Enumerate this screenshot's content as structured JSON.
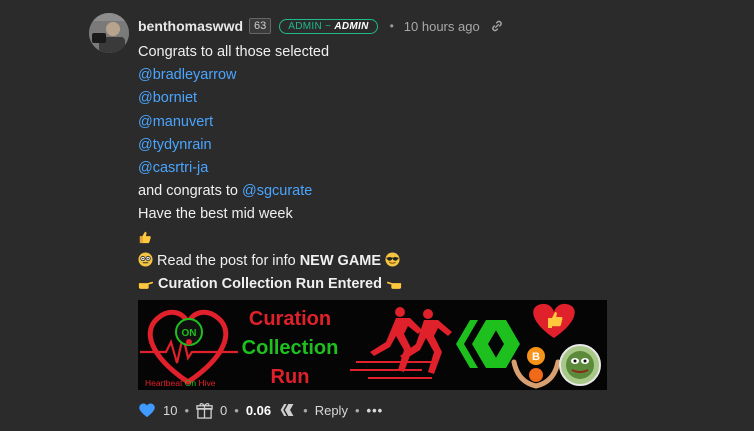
{
  "comment": {
    "author": "benthomaswwd",
    "reputation": "63",
    "role_prefix": "ADMIN ~",
    "role_title": "ADMIN",
    "time_ago": "10 hours ago",
    "lines": {
      "congrats": "Congrats to all those selected",
      "mentions": [
        "@bradleyarrow",
        "@borniet",
        "@manuvert",
        "@tydynrain",
        "@casrtri-ja"
      ],
      "and_congrats": "and congrats to ",
      "and_mention": "@sgcurate",
      "midweek": "Have the best mid week",
      "read_post": "Read the post for info ",
      "new_game": "NEW GAME",
      "curation_entered": "Curation Collection Run Entered"
    }
  },
  "banner": {
    "logo_text": "ON",
    "heartbeat": "Heartbeat",
    "on": "On",
    "hive": "Hive",
    "title_line1": "Curation",
    "title_line2": "Collection",
    "title_line3": "Run"
  },
  "actions": {
    "upvotes": "10",
    "gifts": "0",
    "payout": "0.06",
    "reply": "Reply",
    "more": "•••"
  },
  "colors": {
    "background": "#2b2b2b",
    "mention": "#4aa5ff",
    "admin_badge": "#1fb98a",
    "upvote": "#3f9bff",
    "banner_red": "#e0202a",
    "banner_green": "#1ec01e"
  }
}
